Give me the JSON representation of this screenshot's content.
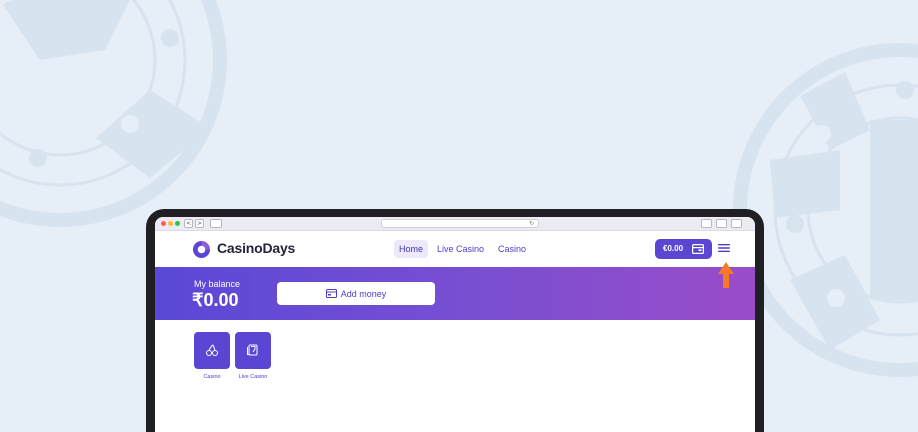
{
  "browser": {
    "back_glyph": "<",
    "forward_glyph": ">",
    "reload_glyph": "↻"
  },
  "site": {
    "brand": "CasinoDays",
    "nav": [
      {
        "label": "Home",
        "active": true
      },
      {
        "label": "Live Casino",
        "active": false
      },
      {
        "label": "Casino",
        "active": false
      }
    ],
    "balance_pill": "€0.00",
    "menu_icon": "hamburger-icon"
  },
  "banner": {
    "balance_label": "My balance",
    "balance_value": "₹0.00",
    "add_money_label": "Add money",
    "add_money_icon": "wallet-icon"
  },
  "categories": [
    {
      "label": "Casino",
      "icon": "cherries-icon"
    },
    {
      "label": "Live Casino",
      "icon": "cards-icon"
    }
  ],
  "colors": {
    "background": "#e6eef7",
    "brand_purple": "#5b46d4",
    "banner_gradient_start": "#5a48d6",
    "banner_gradient_end": "#9a4cc8",
    "highlight_arrow": "#f47a2a"
  }
}
